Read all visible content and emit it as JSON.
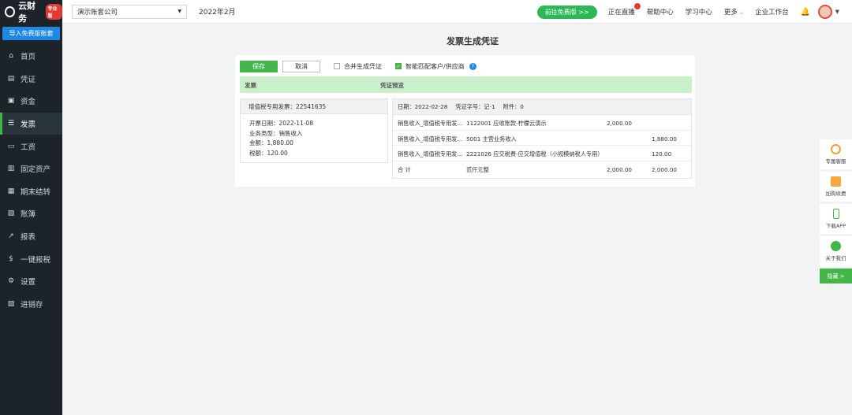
{
  "app": {
    "logo_text": "云财务",
    "logo_badge": "专业版",
    "import_button": "导入免费版账套"
  },
  "sidebar": {
    "items": [
      {
        "label": "首页",
        "icon": "home-icon",
        "glyph": "⌂"
      },
      {
        "label": "凭证",
        "icon": "voucher-icon",
        "glyph": "▤"
      },
      {
        "label": "资金",
        "icon": "fund-icon",
        "glyph": "▣"
      },
      {
        "label": "发票",
        "icon": "invoice-icon",
        "glyph": "☰"
      },
      {
        "label": "工资",
        "icon": "salary-icon",
        "glyph": "▭"
      },
      {
        "label": "固定资产",
        "icon": "asset-icon",
        "glyph": "▥"
      },
      {
        "label": "期末结转",
        "icon": "calendar-icon",
        "glyph": "▦"
      },
      {
        "label": "账簿",
        "icon": "book-icon",
        "glyph": "▧"
      },
      {
        "label": "报表",
        "icon": "chart-icon",
        "glyph": "↗"
      },
      {
        "label": "一键报税",
        "icon": "tax-icon",
        "glyph": "$"
      },
      {
        "label": "设置",
        "icon": "gear-icon",
        "glyph": "⚙"
      },
      {
        "label": "进销存",
        "icon": "inventory-icon",
        "glyph": "▨"
      }
    ]
  },
  "topbar": {
    "company": "演示账套公司",
    "period": "2022年2月",
    "free_button": "前往免费版 >>",
    "live": "正在直播",
    "help": "帮助中心",
    "learn": "学习中心",
    "more": "更多",
    "workbench": "企业工作台"
  },
  "page": {
    "title": "发票生成凭证",
    "save": "保存",
    "cancel": "取消",
    "merge_label": "合并生成凭证",
    "smart_label": "智能匹配客户/供应商",
    "col_invoice": "发票",
    "col_preview": "凭证预览"
  },
  "invoice": {
    "title": "增值税专用发票：22541635",
    "lines": [
      "开票日期：2022-11-08",
      "业务类型：销售收入",
      "金额：1,880.00",
      "税额：120.00"
    ]
  },
  "voucher": {
    "date": "日期：2022-02-28",
    "number": "凭证字号：记-1",
    "attachments": "附件：0",
    "rows": [
      {
        "summary": "销售收入_增值税专用发...",
        "account": "1122001 应收账款-柠檬云演示",
        "debit": "2,000.00",
        "credit": ""
      },
      {
        "summary": "销售收入_增值税专用发...",
        "account": "5001 主营业务收入",
        "debit": "",
        "credit": "1,880.00"
      },
      {
        "summary": "销售收入_增值税专用发...",
        "account": "2221026 应交税费-应交增值税（小规模纳税人专用）",
        "debit": "",
        "credit": "120.00"
      }
    ],
    "total": {
      "label": "合 计",
      "words": "贰仟元整",
      "debit": "2,000.00",
      "credit": "2,000.00"
    }
  },
  "dock": {
    "items": [
      "专属客服",
      "加购续费",
      "下载APP",
      "关于我们"
    ],
    "hide": "隐藏 >"
  }
}
